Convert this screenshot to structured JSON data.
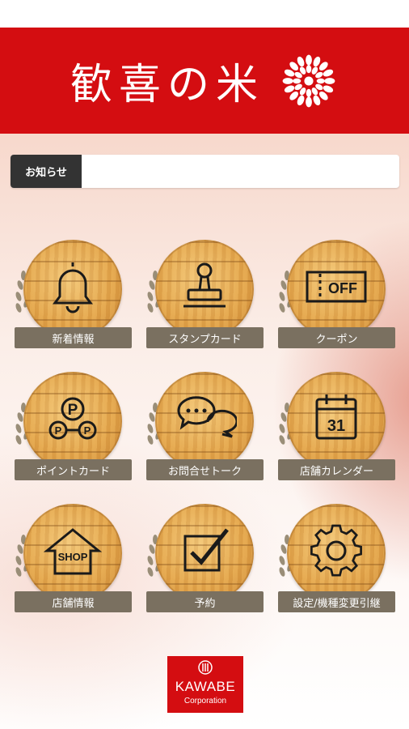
{
  "header": {
    "title": "歓喜の米"
  },
  "notice": {
    "label": "お知らせ",
    "content": ""
  },
  "menu": [
    {
      "label": "新着情報",
      "icon": "bell-icon"
    },
    {
      "label": "スタンプカード",
      "icon": "stamp-icon"
    },
    {
      "label": "クーポン",
      "icon": "coupon-icon",
      "icon_text": "OFF"
    },
    {
      "label": "ポイントカード",
      "icon": "points-icon",
      "icon_text": "P"
    },
    {
      "label": "お問合せトーク",
      "icon": "chat-icon"
    },
    {
      "label": "店舗カレンダー",
      "icon": "calendar-icon",
      "icon_text": "31"
    },
    {
      "label": "店舗情報",
      "icon": "shop-icon",
      "icon_text": "SHOP"
    },
    {
      "label": "予約",
      "icon": "checkbox-icon"
    },
    {
      "label": "設定/機種変更引継",
      "icon": "gear-icon"
    }
  ],
  "footer": {
    "brand": "KAWABE",
    "sub": "Corporation"
  },
  "colors": {
    "brand_red": "#d40d11",
    "label_bg": "#7a7060",
    "notice_label_bg": "#333333"
  }
}
